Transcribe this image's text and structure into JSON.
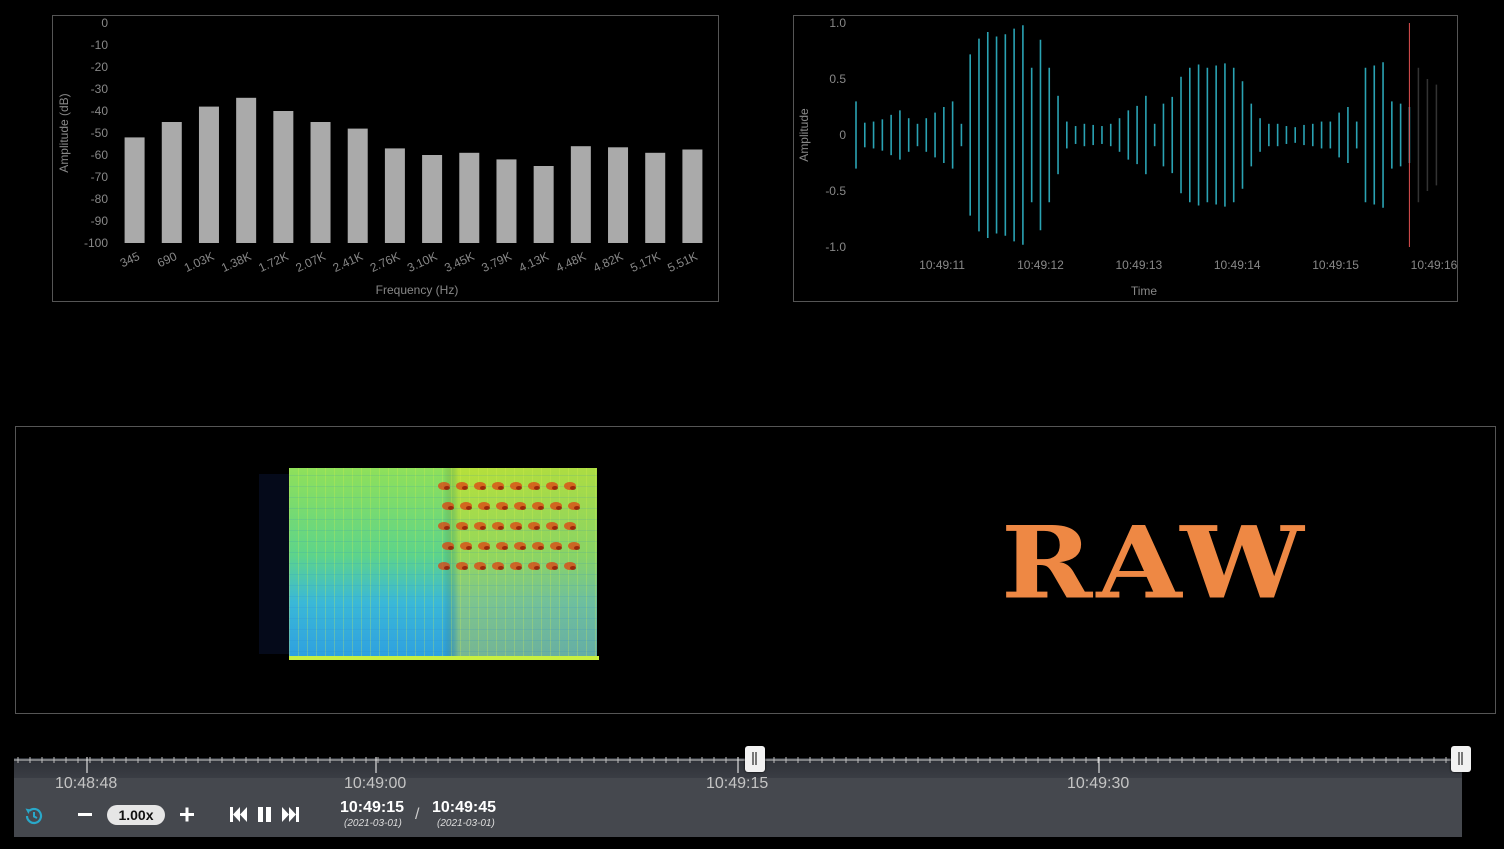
{
  "spectrum": {
    "ylabel": "Amplitude (dB)",
    "xlabel": "Frequency (Hz)",
    "bar_color": "#aaaaaa"
  },
  "waveform": {
    "ylabel": "Amplitude",
    "xlabel": "Time",
    "line_color": "#2aa3b3",
    "cursor_color": "#e05050"
  },
  "chart_data": [
    {
      "type": "bar",
      "xlabel": "Frequency (Hz)",
      "ylabel": "Amplitude (dB)",
      "ylim": [
        -100,
        0
      ],
      "yticks": [
        "0",
        "-10",
        "-20",
        "-30",
        "-40",
        "-50",
        "-60",
        "-70",
        "-80",
        "-90",
        "-100"
      ],
      "categories": [
        "345",
        "690",
        "1.03K",
        "1.38K",
        "1.72K",
        "2.07K",
        "2.41K",
        "2.76K",
        "3.10K",
        "3.45K",
        "3.79K",
        "4.13K",
        "4.48K",
        "4.82K",
        "5.17K",
        "5.51K"
      ],
      "values": [
        -52,
        -45,
        -38,
        -34,
        -40,
        -45,
        -48,
        -57,
        -60,
        -59,
        -62,
        -65,
        -56,
        -56.5,
        -59,
        -57.5
      ]
    },
    {
      "type": "line",
      "xlabel": "Time",
      "ylabel": "Amplitude",
      "ylim": [
        -1.0,
        1.0
      ],
      "yticks": [
        "1.0",
        "0.5",
        "0",
        "-0.5",
        "-1.0"
      ],
      "xticks": [
        "10:49:11",
        "10:49:12",
        "10:49:13",
        "10:49:14",
        "10:49:15",
        "10:49:16"
      ],
      "x_start": "10:49:10.125",
      "x_end": "10:49:16.0",
      "cursor_x": "10:49:15.75",
      "amplitudes": [
        0.3,
        0.11,
        0.12,
        0.14,
        0.18,
        0.22,
        0.15,
        0.1,
        0.15,
        0.2,
        0.25,
        0.3,
        0.1,
        0.72,
        0.86,
        0.92,
        0.88,
        0.9,
        0.95,
        0.98,
        0.6,
        0.85,
        0.6,
        0.35,
        0.12,
        0.08,
        0.1,
        0.09,
        0.08,
        0.1,
        0.15,
        0.22,
        0.26,
        0.35,
        0.1,
        0.28,
        0.34,
        0.52,
        0.6,
        0.63,
        0.6,
        0.62,
        0.64,
        0.6,
        0.48,
        0.28,
        0.15,
        0.1,
        0.1,
        0.08,
        0.07,
        0.09,
        0.1,
        0.12,
        0.12,
        0.2,
        0.25,
        0.12,
        0.6,
        0.62,
        0.65,
        0.3,
        0.28,
        0.25
      ]
    }
  ],
  "media": {
    "raw_label": "RAW",
    "raw_color": "#ee8844"
  },
  "timeline": {
    "tick_labels": [
      "10:48:48",
      "10:49:00",
      "10:49:15",
      "10:49:30"
    ],
    "current_time": "10:49:15",
    "current_date": "(2021-03-01)",
    "separator": "/",
    "end_time": "10:49:45",
    "end_date": "(2021-03-01)",
    "speed": "1.00x",
    "thumb_start_fraction": 0.5,
    "thumb_end_fraction": 1.0
  },
  "controls": {
    "history_icon": "history-icon",
    "minus_icon": "minus-icon",
    "plus_icon": "plus-icon",
    "prev_icon": "skip-previous-icon",
    "pause_icon": "pause-icon",
    "next_icon": "skip-next-icon",
    "accent": "#29a8c9"
  }
}
